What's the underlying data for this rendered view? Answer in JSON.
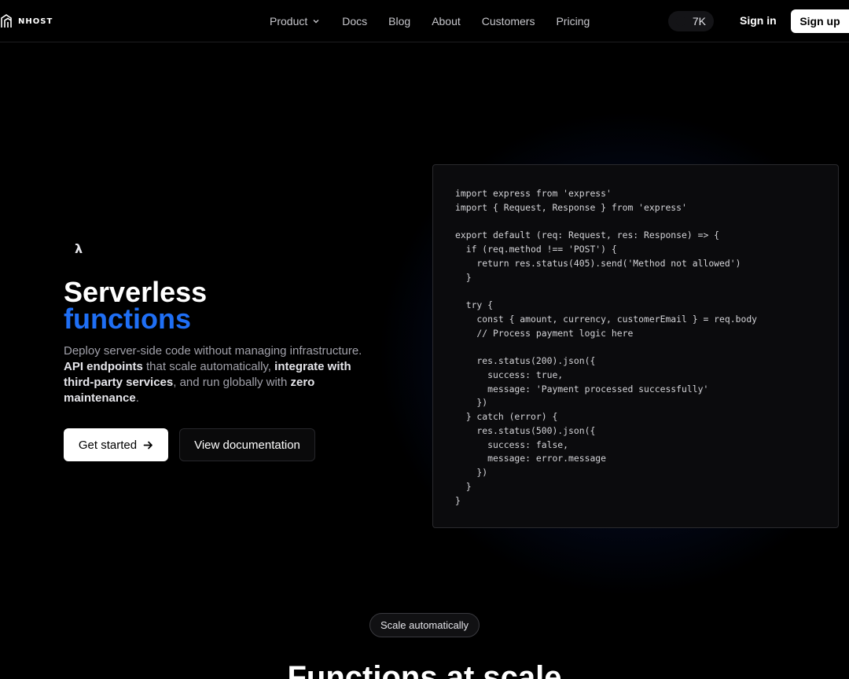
{
  "header": {
    "logo_text": "NHOST",
    "nav": [
      {
        "label": "Product",
        "has_dropdown": true
      },
      {
        "label": "Docs"
      },
      {
        "label": "Blog"
      },
      {
        "label": "About"
      },
      {
        "label": "Customers"
      },
      {
        "label": "Pricing"
      }
    ],
    "github_stars": "7K",
    "sign_in": "Sign in",
    "sign_up": "Sign up"
  },
  "hero": {
    "badge_icon": "λ",
    "title": "Serverless",
    "title_accent": "functions",
    "accent_color": "#1f6ff5",
    "desc_part1": "Deploy server-side code without managing infrastructure. ",
    "desc_bold1": "API endpoints",
    "desc_part2": " that scale automatically, ",
    "desc_bold2": "integrate with third-party services",
    "desc_part3": ", and run globally with ",
    "desc_bold3": "zero maintenance",
    "desc_part4": ".",
    "cta_primary": "Get started",
    "cta_secondary": "View documentation"
  },
  "code_sample": "import express from 'express'\nimport { Request, Response } from 'express'\n\nexport default (req: Request, res: Response) => {\n  if (req.method !== 'POST') {\n    return res.status(405).send('Method not allowed')\n  }\n\n  try {\n    const { amount, currency, customerEmail } = req.body\n    // Process payment logic here\n\n    res.status(200).json({\n      success: true,\n      message: 'Payment processed successfully'\n    })\n  } catch (error) {\n    res.status(500).json({\n      success: false,\n      message: error.message\n    })\n  }\n}",
  "section": {
    "pill": "Scale automatically",
    "title": "Functions at scale"
  }
}
